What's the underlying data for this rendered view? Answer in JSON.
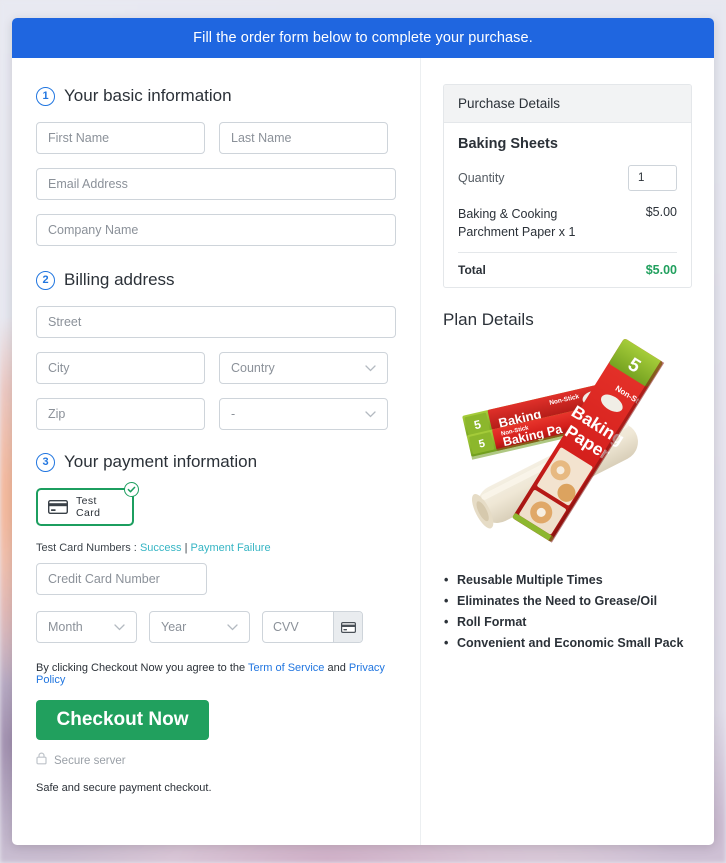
{
  "banner": {
    "text": "Fill the order form below to complete your purchase."
  },
  "sections": {
    "basic": {
      "number": "1",
      "title": "Your basic information",
      "fields": {
        "first_name": "First Name",
        "last_name": "Last Name",
        "email": "Email Address",
        "company": "Company Name"
      }
    },
    "billing": {
      "number": "2",
      "title": "Billing address",
      "fields": {
        "street": "Street",
        "city": "City",
        "country": "Country",
        "zip": "Zip",
        "state": "-"
      }
    },
    "payment": {
      "number": "3",
      "title": "Your payment information",
      "card_option_label": "Test Card",
      "test_numbers_prefix": "Test Card Numbers :",
      "test_success_link": "Success",
      "test_separator": "|",
      "test_failure_link": "Payment Failure",
      "card_number": "Credit Card Number",
      "month": "Month",
      "year": "Year",
      "cvv": "CVV",
      "terms_prefix": "By clicking Checkout Now you agree to the",
      "terms_link": "Term of Service",
      "terms_and": "and",
      "privacy_link": "Privacy Policy",
      "checkout_label": "Checkout Now",
      "secure_label": "Secure server",
      "safe_note": "Safe and secure payment checkout."
    }
  },
  "purchase": {
    "heading": "Purchase Details",
    "product_name": "Baking Sheets",
    "quantity_label": "Quantity",
    "quantity_value": "1",
    "line_item_desc": "Baking & Cooking Parchment Paper x 1",
    "line_item_price": "$5.00",
    "total_label": "Total",
    "total_value": "$5.00"
  },
  "plan": {
    "heading": "Plan Details",
    "product_image_alt": "baking-paper-product-image",
    "features": [
      "Reusable Multiple Times",
      "Eliminates the Need to Grease/Oil",
      "Roll Format",
      "Convenient and Economic Small Pack"
    ]
  },
  "colors": {
    "banner_blue": "#1f66e0",
    "accent_blue": "#2176e0",
    "success_green": "#21a05e",
    "card_border_green": "#1c9e5f",
    "link_teal": "#36b5c4"
  }
}
